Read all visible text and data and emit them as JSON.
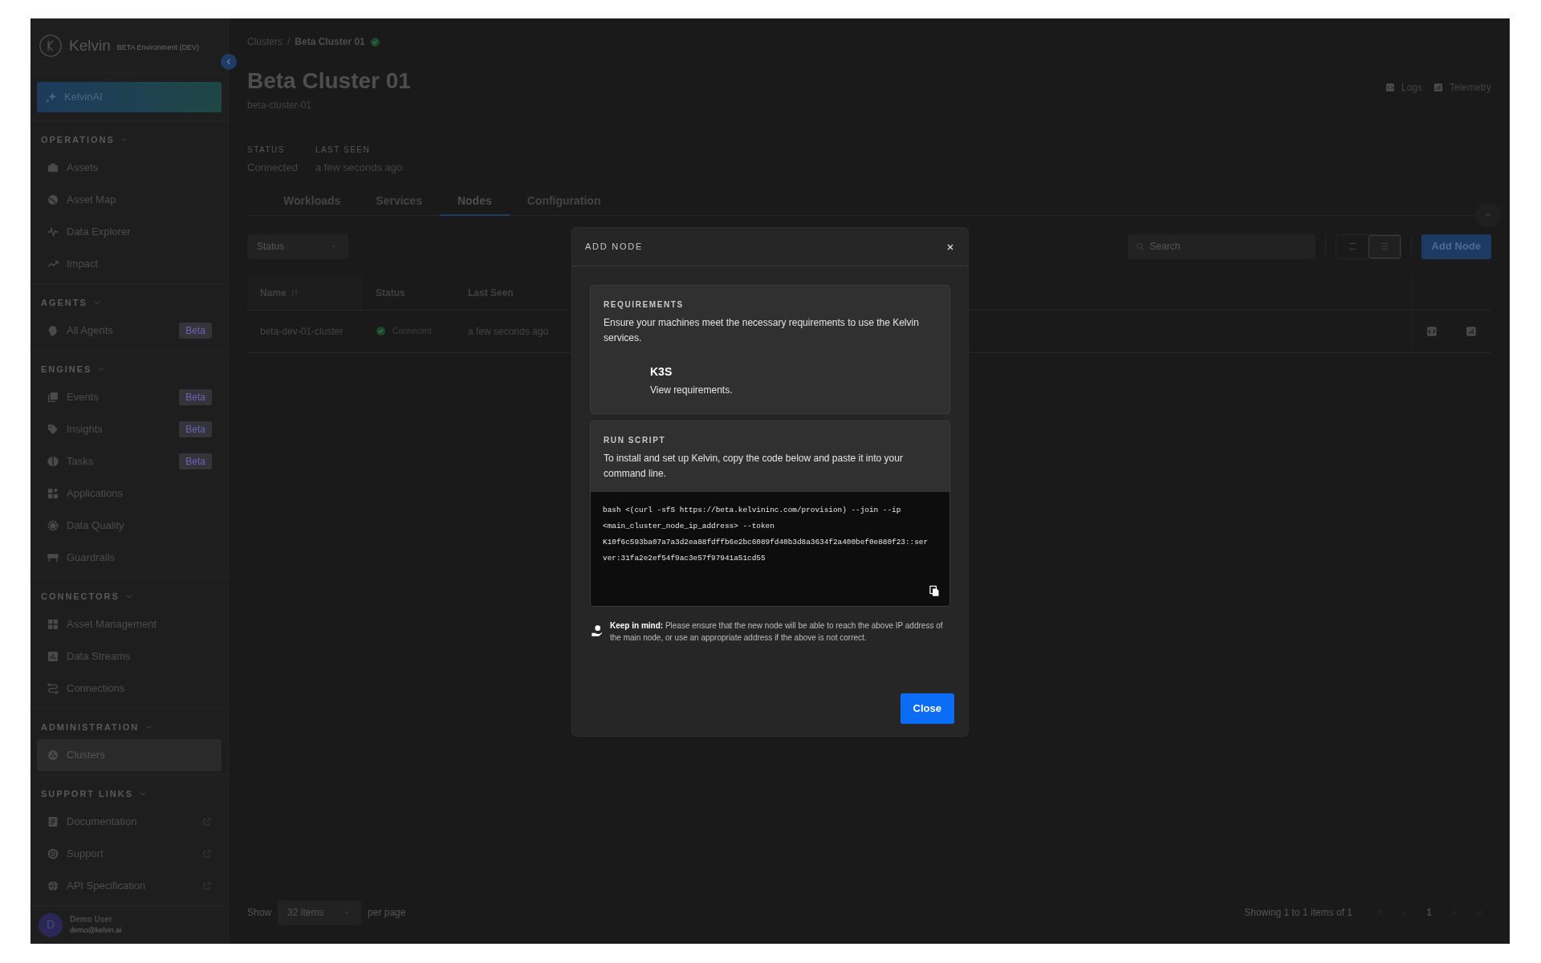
{
  "sidebar": {
    "logo": {
      "name": "Kelvin",
      "environment": "BETA Environment (DEV)"
    },
    "ai_button": "KelvinAI",
    "sections": [
      {
        "title": "OPERATIONS",
        "expanded": true,
        "items": [
          {
            "label": "Assets",
            "selected": false
          },
          {
            "label": "Asset Map",
            "selected": false
          },
          {
            "label": "Data Explorer",
            "selected": false
          },
          {
            "label": "Impact",
            "selected": false
          }
        ]
      },
      {
        "title": "AGENTS",
        "expanded": true,
        "items": [
          {
            "label": "All Agents",
            "badge": "Beta",
            "selected": false
          }
        ]
      },
      {
        "title": "ENGINES",
        "expanded": true,
        "items": [
          {
            "label": "Events",
            "badge": "Beta",
            "selected": false
          },
          {
            "label": "Insights",
            "badge": "Beta",
            "selected": false
          },
          {
            "label": "Tasks",
            "badge": "Beta",
            "selected": false
          },
          {
            "label": "Applications",
            "selected": false
          },
          {
            "label": "Data Quality",
            "selected": false
          },
          {
            "label": "Guardrails",
            "selected": false
          }
        ]
      },
      {
        "title": "CONNECTORS",
        "expanded": true,
        "items": [
          {
            "label": "Asset Management",
            "selected": false
          },
          {
            "label": "Data Streams",
            "selected": false
          },
          {
            "label": "Connections",
            "selected": false
          }
        ]
      },
      {
        "title": "ADMINISTRATION",
        "expanded": true,
        "items": [
          {
            "label": "Clusters",
            "selected": true
          }
        ]
      },
      {
        "title": "SUPPORT LINKS",
        "expanded": true,
        "items": [
          {
            "label": "Documentation",
            "external": true,
            "selected": false
          },
          {
            "label": "Support",
            "external": true,
            "selected": false
          },
          {
            "label": "API Specification",
            "external": true,
            "selected": false
          }
        ]
      }
    ],
    "user": {
      "initial": "D",
      "name": "Demo User",
      "email": "demo@kelvin.ai"
    }
  },
  "breadcrumb": {
    "items": [
      "Clusters",
      "Beta Cluster 01"
    ],
    "separator": "/",
    "connected": true
  },
  "header": {
    "title": "Beta Cluster 01",
    "subtitle": "beta-cluster-01",
    "actions": [
      "Logs",
      "Telemetry"
    ]
  },
  "meta": [
    {
      "label": "STATUS",
      "value": "Connected"
    },
    {
      "label": "LAST SEEN",
      "value": "a few seconds ago"
    }
  ],
  "tabs": [
    {
      "label": "Workloads",
      "selected": false
    },
    {
      "label": "Services",
      "selected": false
    },
    {
      "label": "Nodes",
      "selected": true
    },
    {
      "label": "Configuration",
      "selected": false
    }
  ],
  "toolbar": {
    "filter": "Status",
    "search_placeholder": "Search",
    "view_modes": [
      {
        "selected": false
      },
      {
        "selected": true
      }
    ],
    "add_button": "Add Node"
  },
  "table": {
    "columns": [
      "Name",
      "Status",
      "Last Seen"
    ],
    "rows": [
      {
        "name": "beta-dev-01-cluster",
        "status": "Connected",
        "last_seen": "a few seconds ago"
      }
    ]
  },
  "pagination": {
    "show": "Show",
    "page_size": "32 items",
    "per_page": "per page",
    "summary": "Showing 1 to 1 items of 1",
    "current_page": "1"
  },
  "modal": {
    "title": "ADD NODE",
    "requirements": {
      "heading": "REQUIREMENTS",
      "text": "Ensure your machines meet the necessary requirements to use the Kelvin services.",
      "item_title": "K3S",
      "item_link": "View requirements."
    },
    "run_script": {
      "heading": "RUN SCRIPT",
      "text": "To install and set up Kelvin, copy the code below and paste it into your command line.",
      "code_lines": [
        "bash <(curl -sfS https://beta.kelvininc.com/provision) --join --ip",
        "<main_cluster_node_ip_address> --token",
        "K10f6c593ba07a7a3d2ea88fdffb6e2bc6089fd40b3d8a3634f2a400bef0e880f23::ser",
        "ver:31fa2e2ef54f9ac3e57f97941a51cd55"
      ]
    },
    "note": "**Keep in mind:** Please ensure that the new node will be able to reach the above IP address of the main node, or use an appropriate address if the above is not correct.",
    "close_button": "Close"
  }
}
